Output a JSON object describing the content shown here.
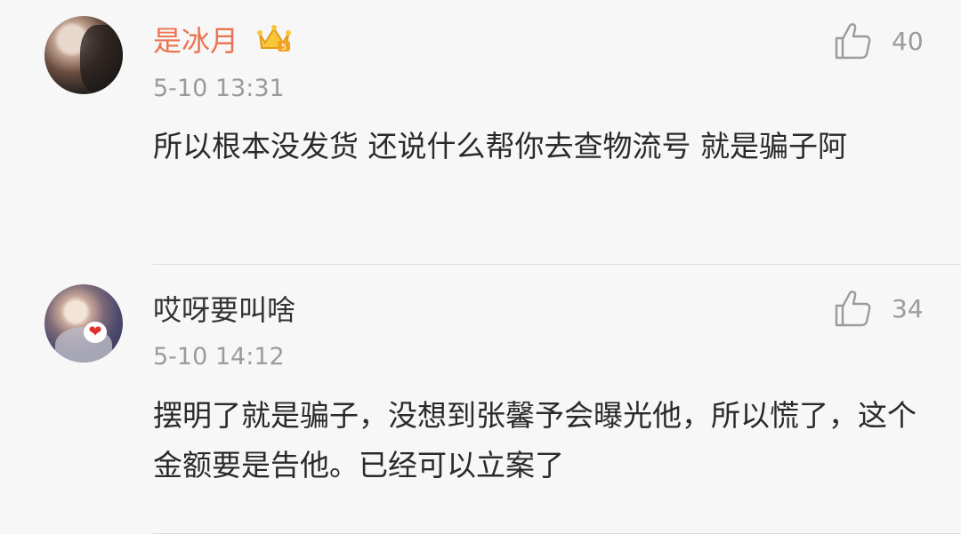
{
  "comments": [
    {
      "username": "是冰月",
      "badge": "vip-crown-icon",
      "timestamp": "5-10 13:31",
      "likes": "40",
      "text": "所以根本没发货 还说什么帮你去查物流号 就是骗子阿"
    },
    {
      "username": "哎呀要叫啥",
      "badge": "heart-icon",
      "timestamp": "5-10 14:12",
      "likes": "34",
      "text": "摆明了就是骗子，没想到张馨予会曝光他，所以慌了，这个金额要是告他。已经可以立案了"
    }
  ],
  "colors": {
    "username_highlight": "#eb7350",
    "username_default": "#333333",
    "meta": "#9b9b9b",
    "background": "#f7f7f7"
  }
}
